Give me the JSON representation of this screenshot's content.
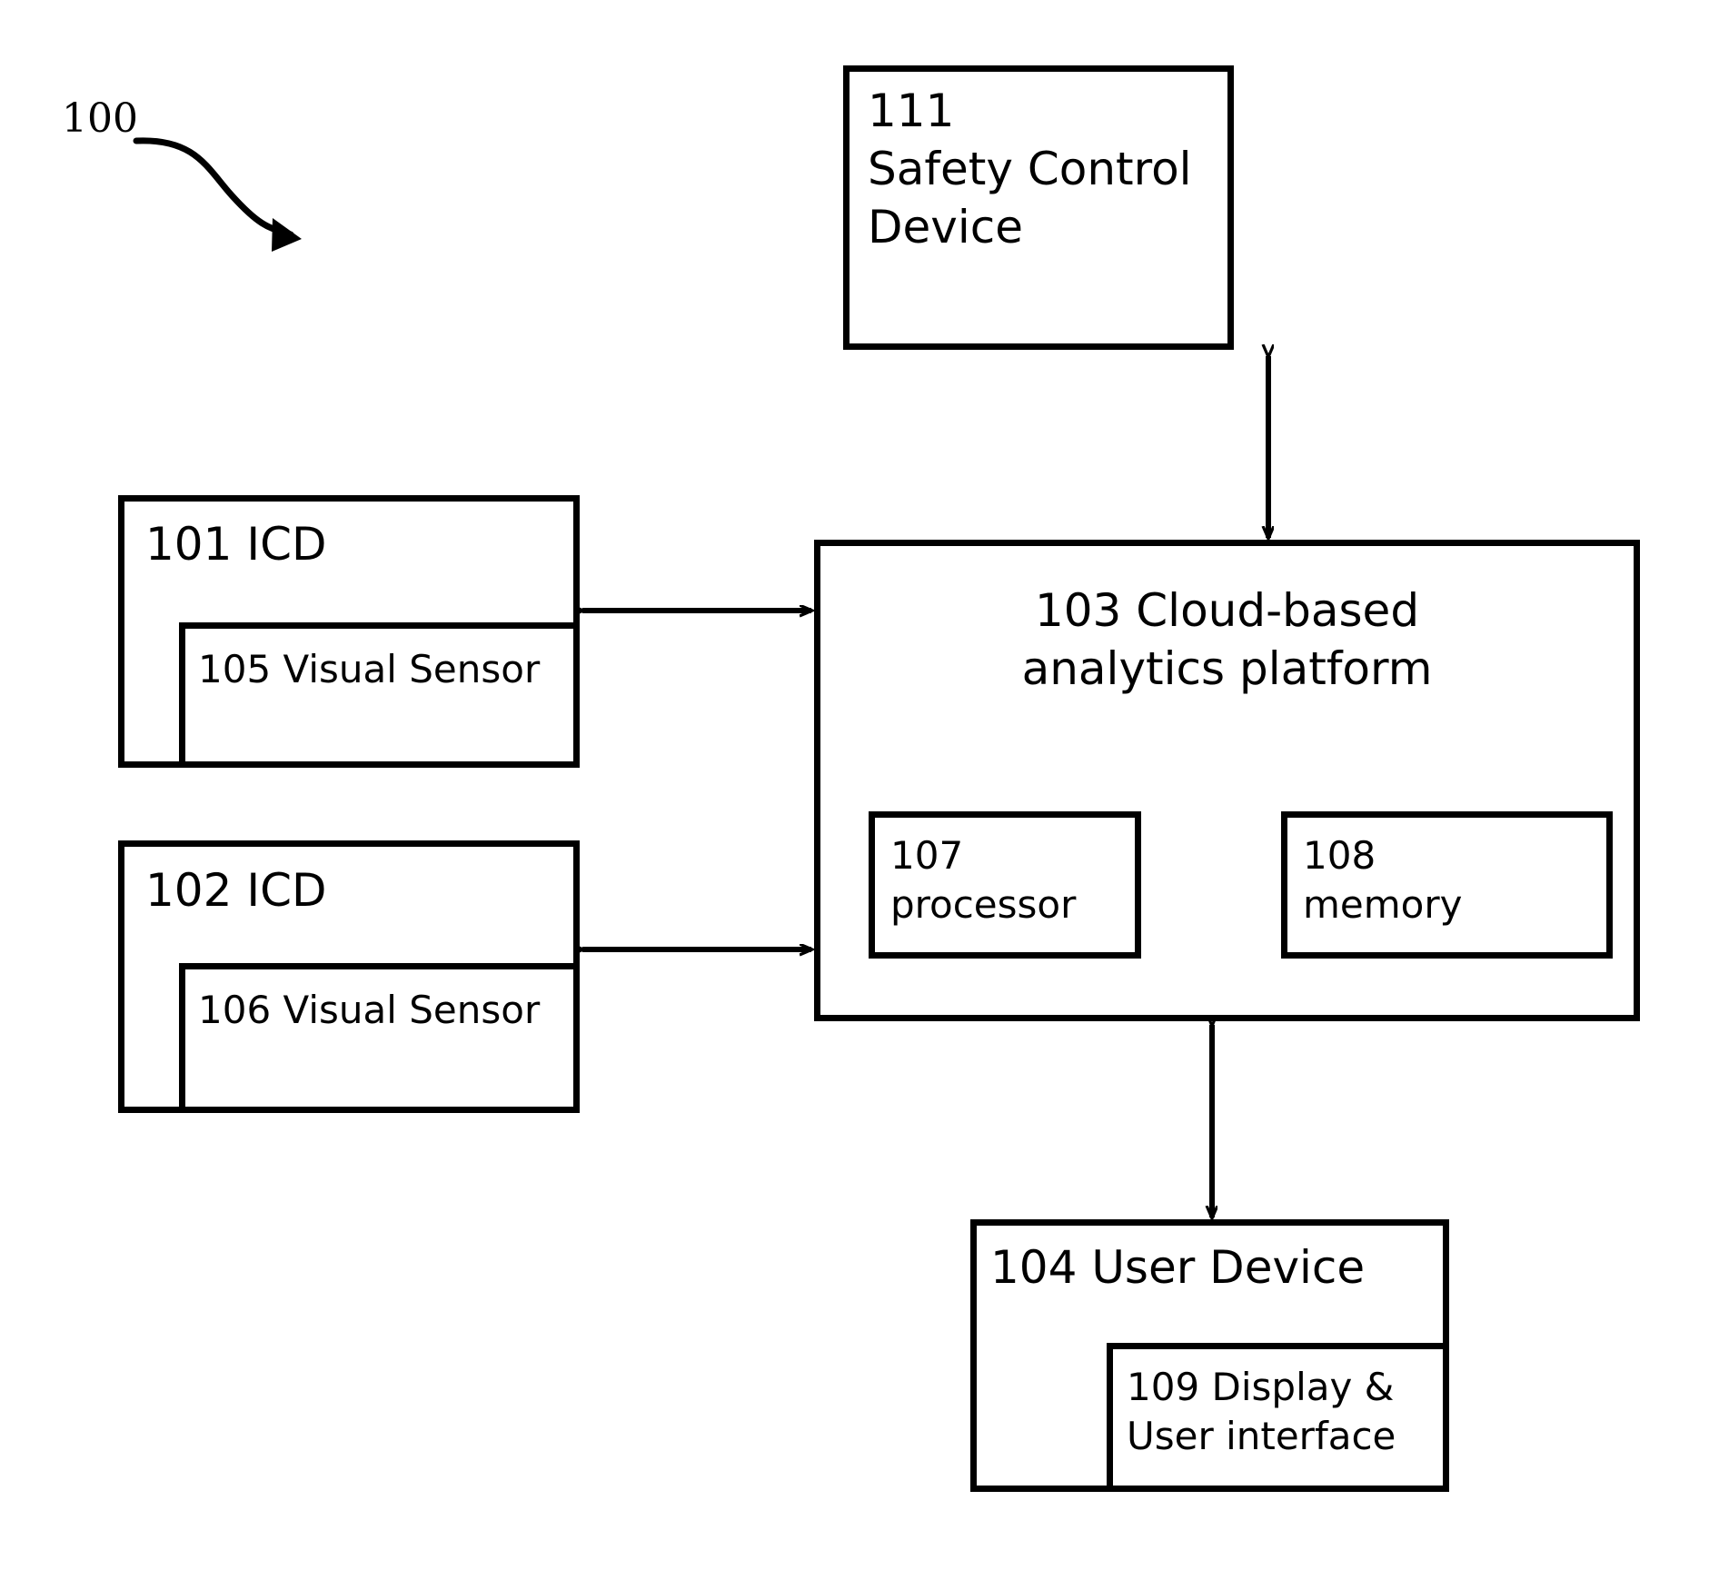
{
  "figure": {
    "reference_numeral": "100",
    "pointer_icon": "curved-arrow-icon"
  },
  "blocks": {
    "safety_control": {
      "id": "111",
      "label": "111\nSafety Control\nDevice"
    },
    "icd_1": {
      "id": "101",
      "label": "101 ICD",
      "inner": {
        "id": "105",
        "label": "105 Visual Sensor"
      }
    },
    "icd_2": {
      "id": "102",
      "label": "102 ICD",
      "inner": {
        "id": "106",
        "label": "106 Visual Sensor"
      }
    },
    "platform": {
      "id": "103",
      "label": "103 Cloud-based\nanalytics platform",
      "processor": {
        "id": "107",
        "label": "107\nprocessor"
      },
      "memory": {
        "id": "108",
        "label": "108\nmemory"
      }
    },
    "user_device": {
      "id": "104",
      "label": "104 User Device",
      "inner": {
        "id": "109",
        "label": "109 Display &\nUser interface"
      }
    }
  },
  "connectors": [
    {
      "name": "safety-control-to-platform",
      "type": "double-arrow",
      "orientation": "vertical"
    },
    {
      "name": "icd1-to-platform",
      "type": "double-arrow",
      "orientation": "horizontal"
    },
    {
      "name": "icd2-to-platform",
      "type": "double-arrow",
      "orientation": "horizontal"
    },
    {
      "name": "processor-to-memory",
      "type": "double-arrow",
      "orientation": "horizontal"
    },
    {
      "name": "platform-to-user-device",
      "type": "double-arrow",
      "orientation": "vertical"
    }
  ],
  "colors": {
    "stroke": "#000000",
    "background": "#ffffff"
  }
}
